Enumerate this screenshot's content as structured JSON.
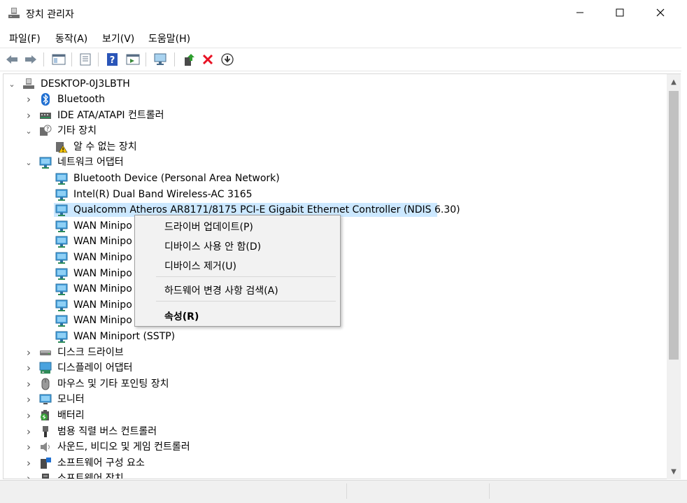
{
  "window": {
    "title": "장치 관리자",
    "minimize_icon": "minimize-icon",
    "maximize_icon": "maximize-icon",
    "close_icon": "close-icon"
  },
  "menu": [
    "파일(F)",
    "동작(A)",
    "보기(V)",
    "도움말(H)"
  ],
  "toolbar": {
    "icons": [
      "back-arrow-icon",
      "forward-arrow-icon",
      "show-hide-console-tree-icon",
      "properties-icon",
      "help-icon",
      "action-pane-icon",
      "scan-hardware-icon",
      "update-driver-icon",
      "uninstall-device-icon",
      "disable-device-icon"
    ]
  },
  "tree": {
    "root": "DESKTOP-0J3LBTH",
    "items": [
      {
        "label": "Bluetooth",
        "icon": "bluetooth-icon",
        "expander": "collapsed"
      },
      {
        "label": "IDE ATA/ATAPI 컨트롤러",
        "icon": "ide-controller-icon",
        "expander": "collapsed"
      },
      {
        "label": "기타 장치",
        "icon": "other-devices-icon",
        "expander": "expanded"
      },
      {
        "label": "알 수 없는 장치",
        "icon": "unknown-device-warning-icon",
        "expander": "none"
      },
      {
        "label": "네트워크 어댑터",
        "icon": "network-adapter-icon",
        "expander": "expanded"
      },
      {
        "label": "Bluetooth Device (Personal Area Network)",
        "icon": "network-adapter-icon",
        "expander": "none"
      },
      {
        "label": "Intel(R) Dual Band Wireless-AC 3165",
        "icon": "network-adapter-icon",
        "expander": "none"
      },
      {
        "label": "Qualcomm Atheros AR8171/8175 PCI-E Gigabit Ethernet Controller (NDIS 6.30)",
        "icon": "network-adapter-icon",
        "expander": "none",
        "selected": true
      },
      {
        "label": "WAN Minipo",
        "icon": "network-adapter-icon",
        "expander": "none"
      },
      {
        "label": "WAN Minipo",
        "icon": "network-adapter-icon",
        "expander": "none"
      },
      {
        "label": "WAN Minipo",
        "icon": "network-adapter-icon",
        "expander": "none"
      },
      {
        "label": "WAN Minipo",
        "icon": "network-adapter-icon",
        "expander": "none"
      },
      {
        "label": "WAN Minipo",
        "icon": "network-adapter-icon",
        "expander": "none"
      },
      {
        "label": "WAN Minipo",
        "icon": "network-adapter-icon",
        "expander": "none"
      },
      {
        "label": "WAN Minipo",
        "icon": "network-adapter-icon",
        "expander": "none"
      },
      {
        "label": "WAN Miniport (SSTP)",
        "icon": "network-adapter-icon",
        "expander": "none"
      },
      {
        "label": "디스크 드라이브",
        "icon": "disk-drive-icon",
        "expander": "collapsed"
      },
      {
        "label": "디스플레이 어댑터",
        "icon": "display-adapter-icon",
        "expander": "collapsed"
      },
      {
        "label": "마우스 및 기타 포인팅 장치",
        "icon": "mouse-icon",
        "expander": "collapsed"
      },
      {
        "label": "모니터",
        "icon": "monitor-icon",
        "expander": "collapsed"
      },
      {
        "label": "배터리",
        "icon": "battery-icon",
        "expander": "collapsed"
      },
      {
        "label": "범용 직렬 버스 컨트롤러",
        "icon": "usb-controller-icon",
        "expander": "collapsed"
      },
      {
        "label": "사운드, 비디오 및 게임 컨트롤러",
        "icon": "sound-icon",
        "expander": "collapsed"
      },
      {
        "label": "소프트웨어 구성 요소",
        "icon": "software-component-icon",
        "expander": "collapsed"
      },
      {
        "label": "소프트웨어 장치",
        "icon": "software-device-icon",
        "expander": "collapsed"
      }
    ]
  },
  "context_menu": {
    "items": [
      {
        "label": "드라이버 업데이트(P)"
      },
      {
        "label": "디바이스 사용 안 함(D)"
      },
      {
        "label": "디바이스 제거(U)"
      },
      {
        "label": "하드웨어 변경 사항 검색(A)"
      },
      {
        "label": "속성(R)",
        "bold": true
      }
    ]
  },
  "colors": {
    "selection": "#cce8ff",
    "menu_bg": "#f2f2f2",
    "accent_red": "#e81123"
  }
}
